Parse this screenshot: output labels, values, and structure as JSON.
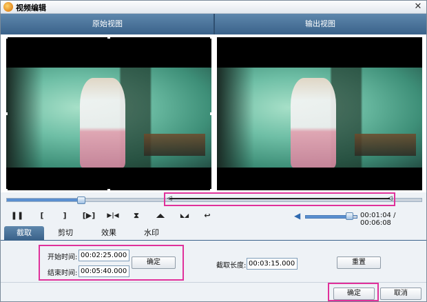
{
  "window": {
    "title": "视频编辑",
    "close_glyph": "✕"
  },
  "views": {
    "original_label": "原始视图",
    "output_label": "输出视图"
  },
  "playback": {
    "progress_fraction": 0.178,
    "current_time": "00:01:04",
    "separator": " / ",
    "total_time": "00:06:08",
    "volume_fraction": 0.85,
    "trim_start_glyph": "◁",
    "trim_end_glyph": "◁"
  },
  "controls": [
    {
      "name": "pause-button",
      "glyph": "❚❚"
    },
    {
      "name": "mark-in-button",
      "glyph": "["
    },
    {
      "name": "mark-out-button",
      "glyph": "]"
    },
    {
      "name": "play-selection-button",
      "glyph": "[▶]"
    },
    {
      "name": "goto-marks-button",
      "glyph": "▶|◀"
    },
    {
      "name": "center-marks-button",
      "glyph": "⧗"
    },
    {
      "name": "trim-left-button",
      "glyph": "◢◣"
    },
    {
      "name": "trim-right-button",
      "glyph": "◣◢"
    },
    {
      "name": "undo-button",
      "glyph": "↩"
    }
  ],
  "tabs": [
    "截取",
    "剪切",
    "效果",
    "水印"
  ],
  "crop_panel": {
    "start_label": "开始时间:",
    "start_value": "00:02:25.000",
    "end_label": "结束时间:",
    "end_value": "00:05:40.000",
    "confirm_label": "确定",
    "length_label": "截取长度:",
    "length_value": "00:03:15.000",
    "reset_label": "重置"
  },
  "footer": {
    "ok_label": "确定",
    "cancel_label": "取消"
  },
  "colors": {
    "header_blue": "#3a628a",
    "highlight_pink": "#e0309a",
    "progress_blue": "#5a8fd0"
  }
}
